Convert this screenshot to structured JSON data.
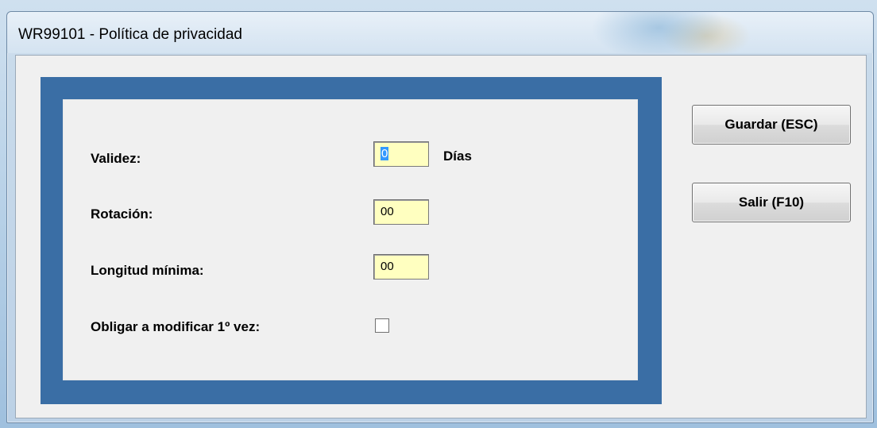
{
  "window": {
    "title": "WR99101 - Política de privacidad"
  },
  "form": {
    "validez": {
      "label": "Validez:",
      "value": "0",
      "unit": "Días"
    },
    "rotacion": {
      "label": "Rotación:",
      "value": "00"
    },
    "longitud_minima": {
      "label": "Longitud mínima:",
      "value": "00"
    },
    "obligar": {
      "label": "Obligar a modificar 1º vez:",
      "checked": false
    }
  },
  "buttons": {
    "guardar": "Guardar (ESC)",
    "salir": "Salir (F10)"
  },
  "colors": {
    "panel_frame": "#3a6ea5",
    "field_background": "#ffffc0",
    "selection": "#3399ff"
  }
}
